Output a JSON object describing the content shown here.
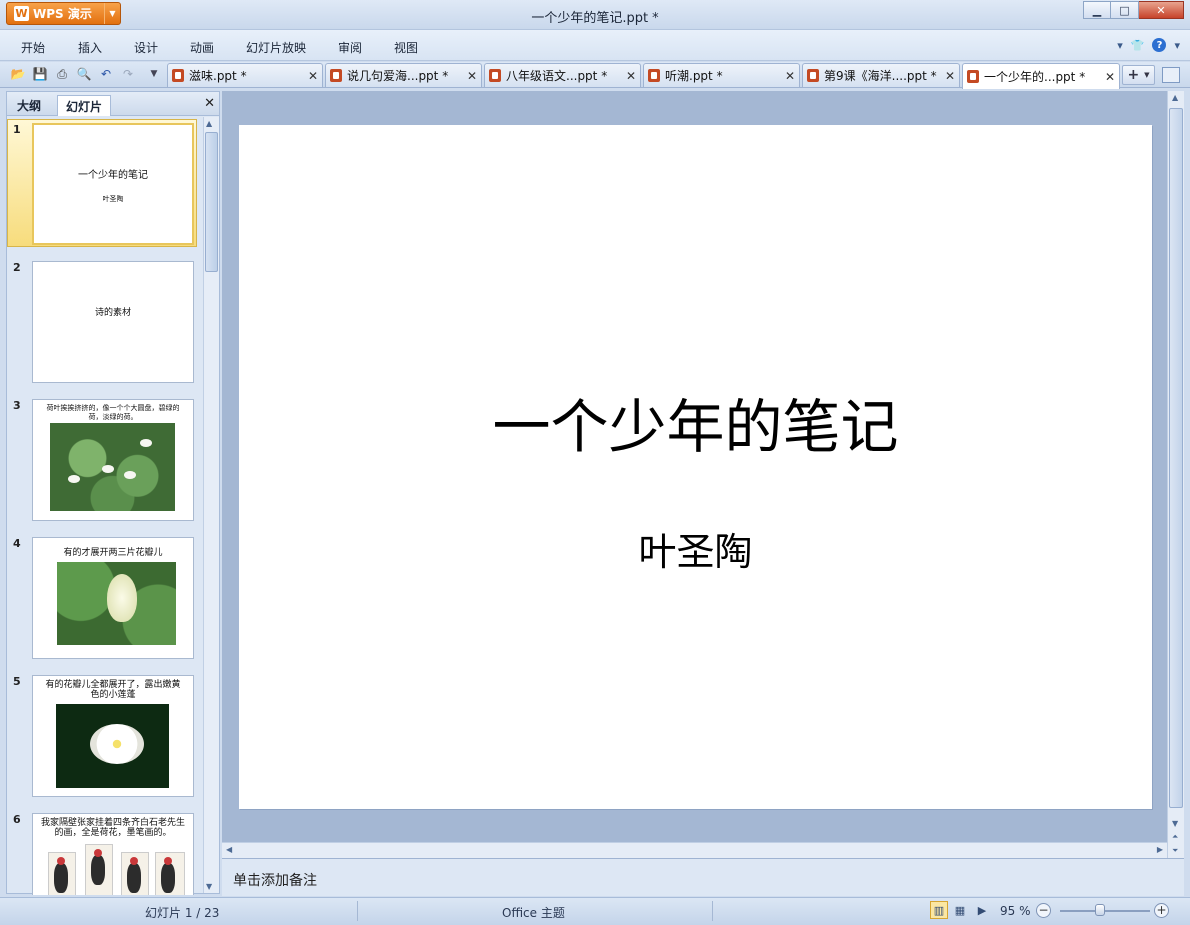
{
  "app": {
    "name": "WPS 演示",
    "window_title": "一个少年的笔记.ppt *"
  },
  "menu": [
    "开始",
    "插入",
    "设计",
    "动画",
    "幻灯片放映",
    "审阅",
    "视图"
  ],
  "doc_tabs": [
    {
      "label": "滋味.ppt *",
      "active": false
    },
    {
      "label": "说几句爱海...ppt *",
      "active": false
    },
    {
      "label": "八年级语文...ppt *",
      "active": false
    },
    {
      "label": "听潮.ppt *",
      "active": false
    },
    {
      "label": "第9课《海洋....ppt *",
      "active": false
    },
    {
      "label": "一个少年的...ppt *",
      "active": true
    }
  ],
  "left_panel": {
    "tabs": [
      "大纲",
      "幻灯片"
    ],
    "active_tab": "幻灯片",
    "slides": [
      {
        "num": "1",
        "text": "一个少年的笔记",
        "sub": "叶圣陶"
      },
      {
        "num": "2",
        "text": "诗的素材"
      },
      {
        "num": "3",
        "text": "荷叶挨挨挤挤的，像一个个大圆盘，碧绿的荷，淡绿的荷。"
      },
      {
        "num": "4",
        "text": "有的才展开两三片花瓣儿"
      },
      {
        "num": "5",
        "text": "有的花瓣儿全都展开了，露出嫩黄色的小莲蓬"
      },
      {
        "num": "6",
        "text": "我家隔壁张家挂着四条齐白石老先生的画，全是荷花，墨笔画的。"
      }
    ]
  },
  "slide": {
    "title": "一个少年的笔记",
    "subtitle": "叶圣陶"
  },
  "notes_placeholder": "单击添加备注",
  "status": {
    "slide_counter": "幻灯片 1 / 23",
    "theme": "Office 主题",
    "zoom": "95 %"
  }
}
